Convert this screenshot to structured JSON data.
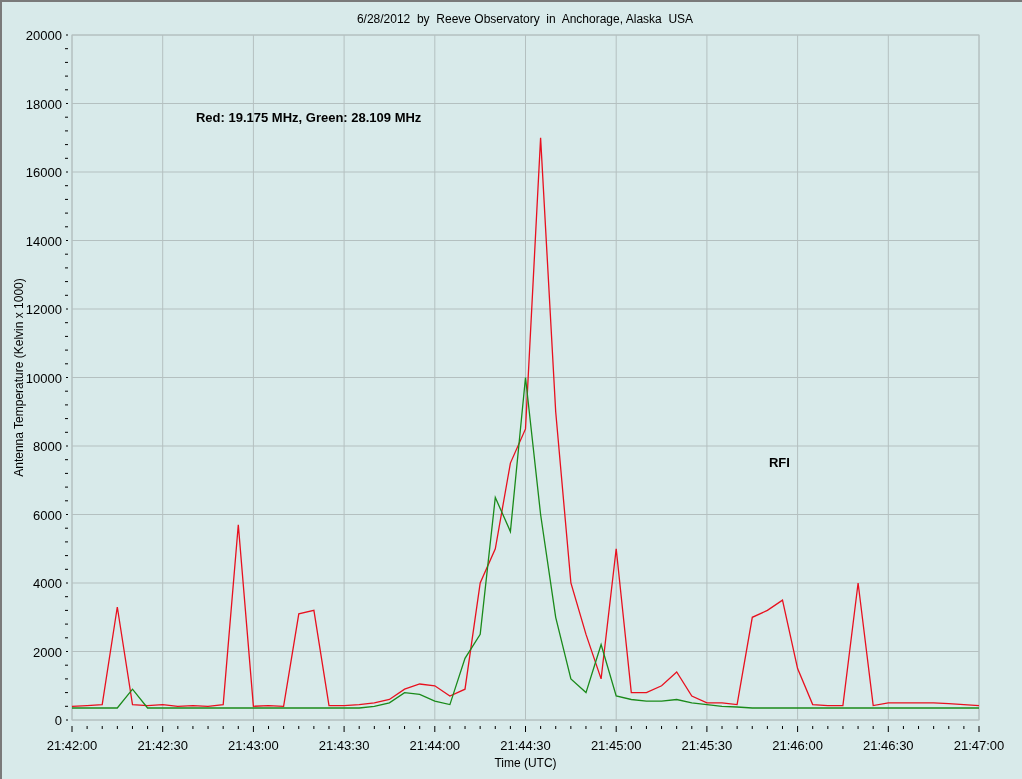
{
  "chart": {
    "chart_data": {
      "type": "line",
      "title": "6/28/2012  by  Reeve Observatory  in  Anchorage, Alaska  USA",
      "xlabel": "Time (UTC)",
      "ylabel": "Antenna Temperature (Kelvin x 1000)",
      "categories": [
        "21:42:00",
        null,
        null,
        null,
        null,
        null,
        "21:42:30",
        null,
        null,
        null,
        null,
        null,
        "21:43:00",
        null,
        null,
        null,
        null,
        null,
        "21:43:30",
        null,
        null,
        null,
        null,
        null,
        "21:44:00",
        null,
        null,
        null,
        null,
        null,
        "21:44:30",
        null,
        null,
        null,
        null,
        null,
        "21:45:00",
        null,
        null,
        null,
        null,
        null,
        "21:45:30",
        null,
        null,
        null,
        null,
        null,
        "21:46:00",
        null,
        null,
        null,
        null,
        null,
        "21:46:30",
        null,
        null,
        null,
        null,
        null,
        "21:47:00"
      ],
      "series": [
        {
          "color": "#e8101e",
          "values": [
            400,
            420,
            450,
            3300,
            450,
            420,
            450,
            400,
            420,
            400,
            450,
            5700,
            400,
            420,
            400,
            3100,
            3200,
            420,
            420,
            450,
            500,
            600,
            900,
            1050,
            1000,
            700,
            900,
            4000,
            5000,
            7500,
            8500,
            17000,
            9000,
            4000,
            2500,
            1200,
            5000,
            800,
            800,
            1000,
            1400,
            700,
            500,
            500,
            450,
            3000,
            3200,
            3500,
            1500,
            450,
            420,
            420,
            4000,
            420,
            500,
            500,
            500,
            500,
            480,
            450,
            420
          ]
        },
        {
          "color": "#1a8a1a",
          "values": [
            350,
            350,
            350,
            350,
            900,
            350,
            350,
            350,
            350,
            350,
            350,
            350,
            350,
            350,
            350,
            350,
            350,
            350,
            350,
            350,
            400,
            500,
            800,
            750,
            550,
            450,
            1800,
            2500,
            6500,
            5500,
            10000,
            6000,
            3000,
            1200,
            800,
            2200,
            700,
            600,
            550,
            550,
            600,
            500,
            450,
            400,
            380,
            350,
            350,
            350,
            350,
            350,
            350,
            350,
            350,
            350,
            350,
            350,
            350,
            350,
            350,
            350,
            350
          ]
        }
      ],
      "ylim": [
        0,
        20000
      ],
      "grid": true,
      "yticks": [
        0,
        2000,
        4000,
        6000,
        8000,
        10000,
        12000,
        14000,
        16000,
        18000,
        20000
      ],
      "annotations": [
        "Red: 19.175 MHz, Green: 28.109 MHz",
        "RFI"
      ]
    }
  }
}
